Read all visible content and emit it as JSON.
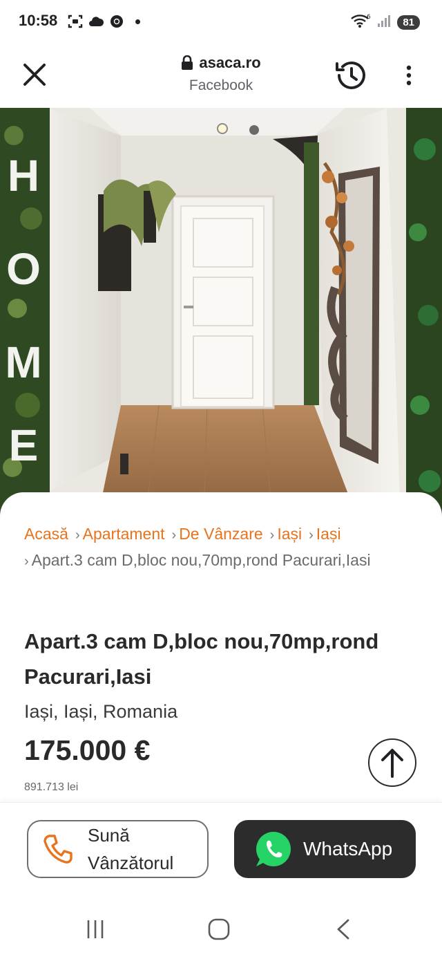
{
  "status_bar": {
    "time": "10:58",
    "battery": "81",
    "icons": [
      "screenshot-icon",
      "cloud-icon",
      "chrome-icon",
      "notification-dot",
      "wifi-icon",
      "signal-icon",
      "battery-icon"
    ]
  },
  "toolbar": {
    "host": "asaca.ro",
    "subtitle": "Facebook",
    "icons": [
      "close-icon",
      "lock-icon",
      "history-icon",
      "more-vert-icon"
    ]
  },
  "hero": {
    "wall_letters": [
      "H",
      "O",
      "M",
      "E"
    ]
  },
  "breadcrumb": {
    "items": [
      "Acasă",
      "Apartament",
      "De Vânzare",
      "Iași",
      "Iași"
    ],
    "current": "Apart.3 cam D,bloc nou,70mp,rond Pacurari,Iasi",
    "separator": "›"
  },
  "listing": {
    "title": "Apart.3 cam D,bloc nou,70mp,rond Pacurari,Iasi",
    "location": "Iași, Iași, Romania",
    "price": "175.000 €",
    "price_lei": "891.713 lei"
  },
  "actions": {
    "call_label_line1": "Sună",
    "call_label_line2": "Vânzătorul",
    "whatsapp_label": "WhatsApp"
  },
  "colors": {
    "accent": "#e8731c",
    "whatsapp_green": "#25d366",
    "dark_button": "#2c2c2c"
  }
}
